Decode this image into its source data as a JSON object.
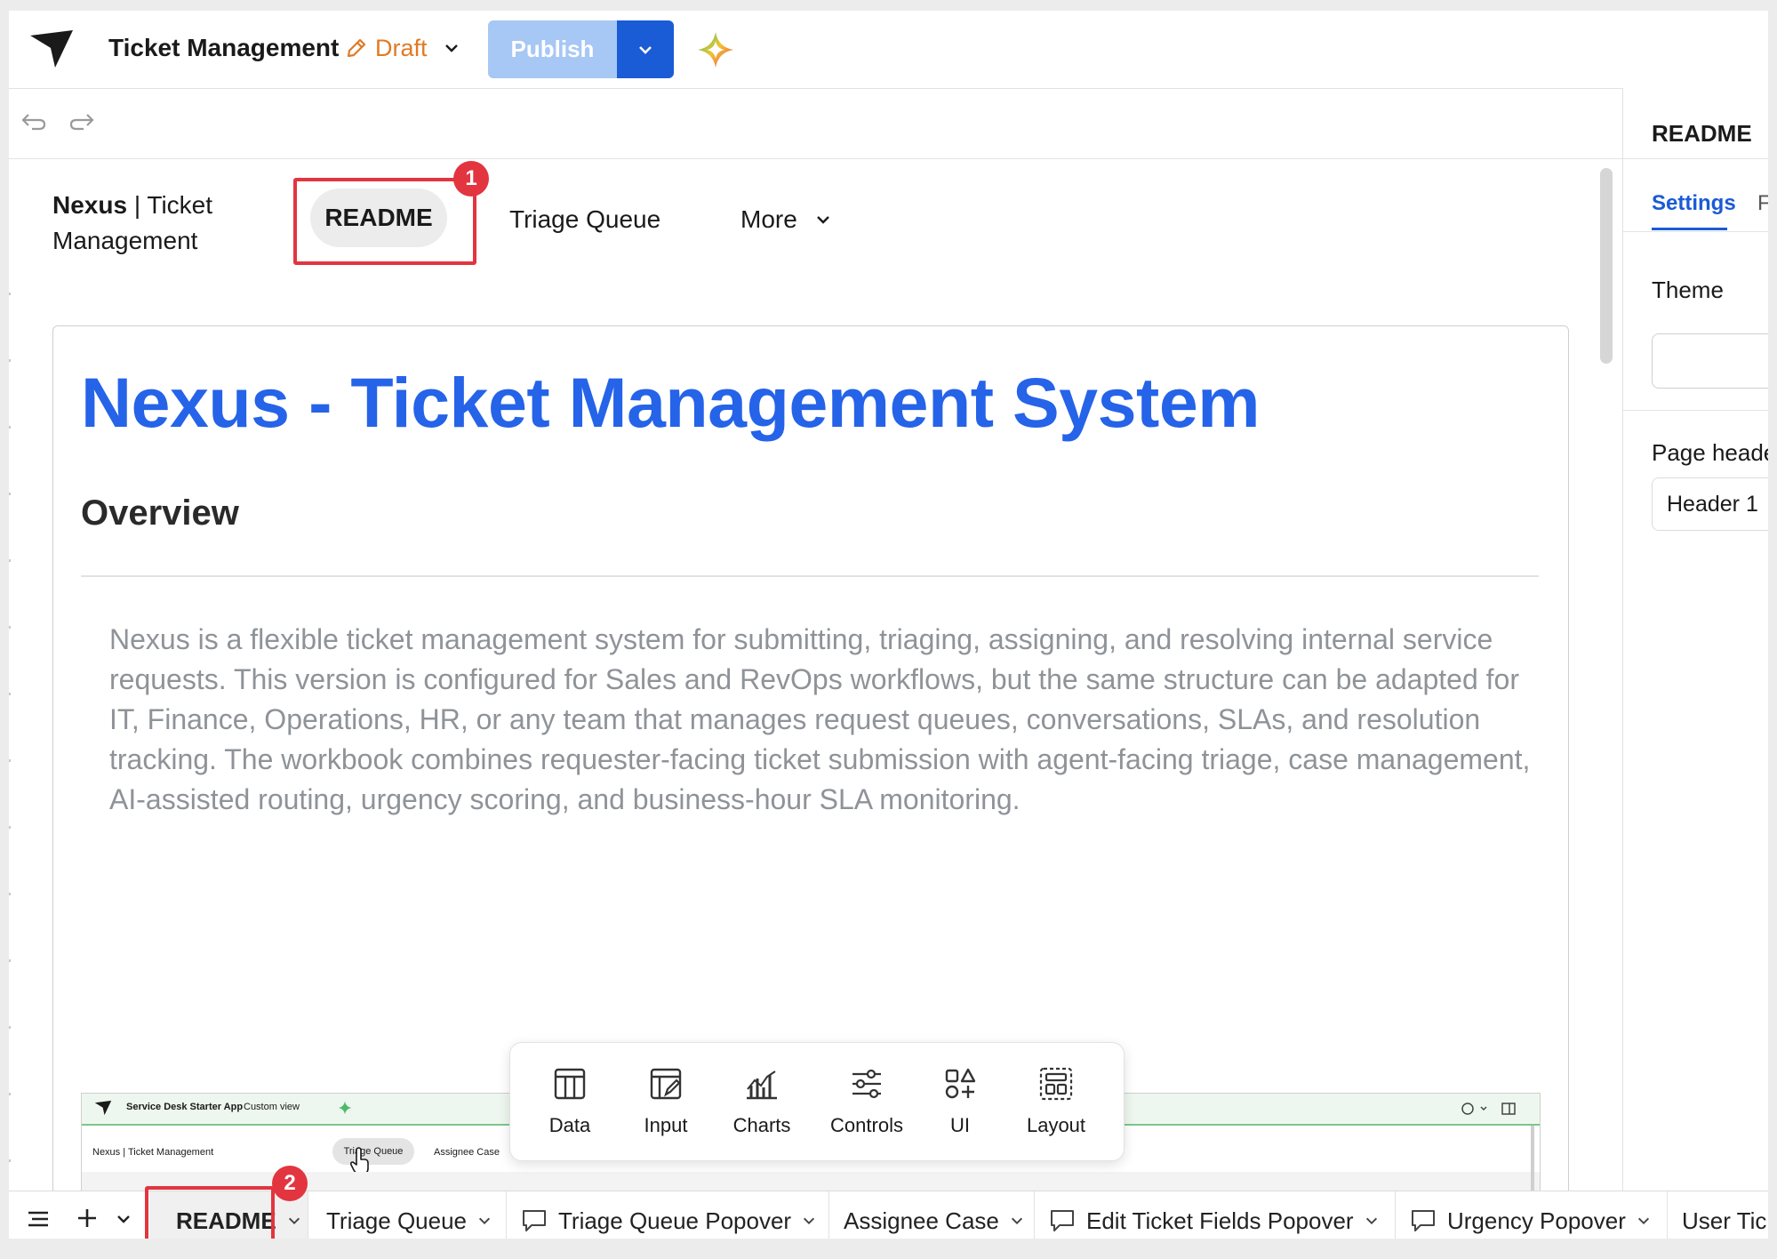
{
  "header": {
    "app_title": "Ticket Management",
    "status": "Draft",
    "publish_label": "Publish"
  },
  "right_panel": {
    "title": "README",
    "tabs": [
      "Settings",
      "Fo"
    ],
    "active_tab": "Settings",
    "theme_label": "Theme",
    "theme_value": "",
    "page_header_label": "Page heade",
    "page_header_value": "Header 1"
  },
  "page_nav": {
    "brand_bold": "Nexus",
    "brand_sep": " | ",
    "brand_rest": "Ticket Management",
    "items": [
      "README",
      "Triage Queue",
      "More"
    ],
    "active": "README"
  },
  "document": {
    "title": "Nexus - Ticket Management System",
    "subtitle": "Overview",
    "paragraph": "Nexus is a flexible ticket management system for submitting, triaging, assigning, and resolving internal service requests. This version is configured for Sales and RevOps workflows, but the same structure can be adapted for IT, Finance, Operations, HR, or any team that manages request queues, conversations, SLAs, and resolution tracking. The workbook combines requester-facing ticket submission with agent-facing triage, case management, AI-assisted routing, urgency scoring, and business-hour SLA monitoring."
  },
  "embedded_screenshot": {
    "app_title": "Service Desk Starter App",
    "view": "Custom view",
    "brand": "Nexus | Ticket Management",
    "active_pill": "Triage Queue",
    "next_item": "Assignee Case"
  },
  "insert_toolbar": {
    "items": [
      {
        "label": "Data",
        "icon": "table-icon"
      },
      {
        "label": "Input",
        "icon": "input-icon"
      },
      {
        "label": "Charts",
        "icon": "charts-icon"
      },
      {
        "label": "Controls",
        "icon": "sliders-icon"
      },
      {
        "label": "UI",
        "icon": "shapes-icon"
      },
      {
        "label": "Layout",
        "icon": "layout-icon"
      }
    ]
  },
  "bottom_tabs": [
    {
      "label": "README",
      "active": true,
      "popover": false
    },
    {
      "label": "Triage Queue",
      "active": false,
      "popover": false
    },
    {
      "label": "Triage Queue Popover",
      "active": false,
      "popover": true
    },
    {
      "label": "Assignee Case",
      "active": false,
      "popover": false
    },
    {
      "label": "Edit Ticket Fields Popover",
      "active": false,
      "popover": true
    },
    {
      "label": "Urgency Popover",
      "active": false,
      "popover": true
    },
    {
      "label": "User Tick",
      "active": false,
      "popover": false
    }
  ],
  "callouts": [
    "1",
    "2"
  ],
  "colors": {
    "accent_blue": "#1a5bd6",
    "title_blue": "#2563e8",
    "draft_orange": "#e07a24",
    "callout_red": "#e2353f",
    "publish_disabled": "#a7c7f5"
  }
}
